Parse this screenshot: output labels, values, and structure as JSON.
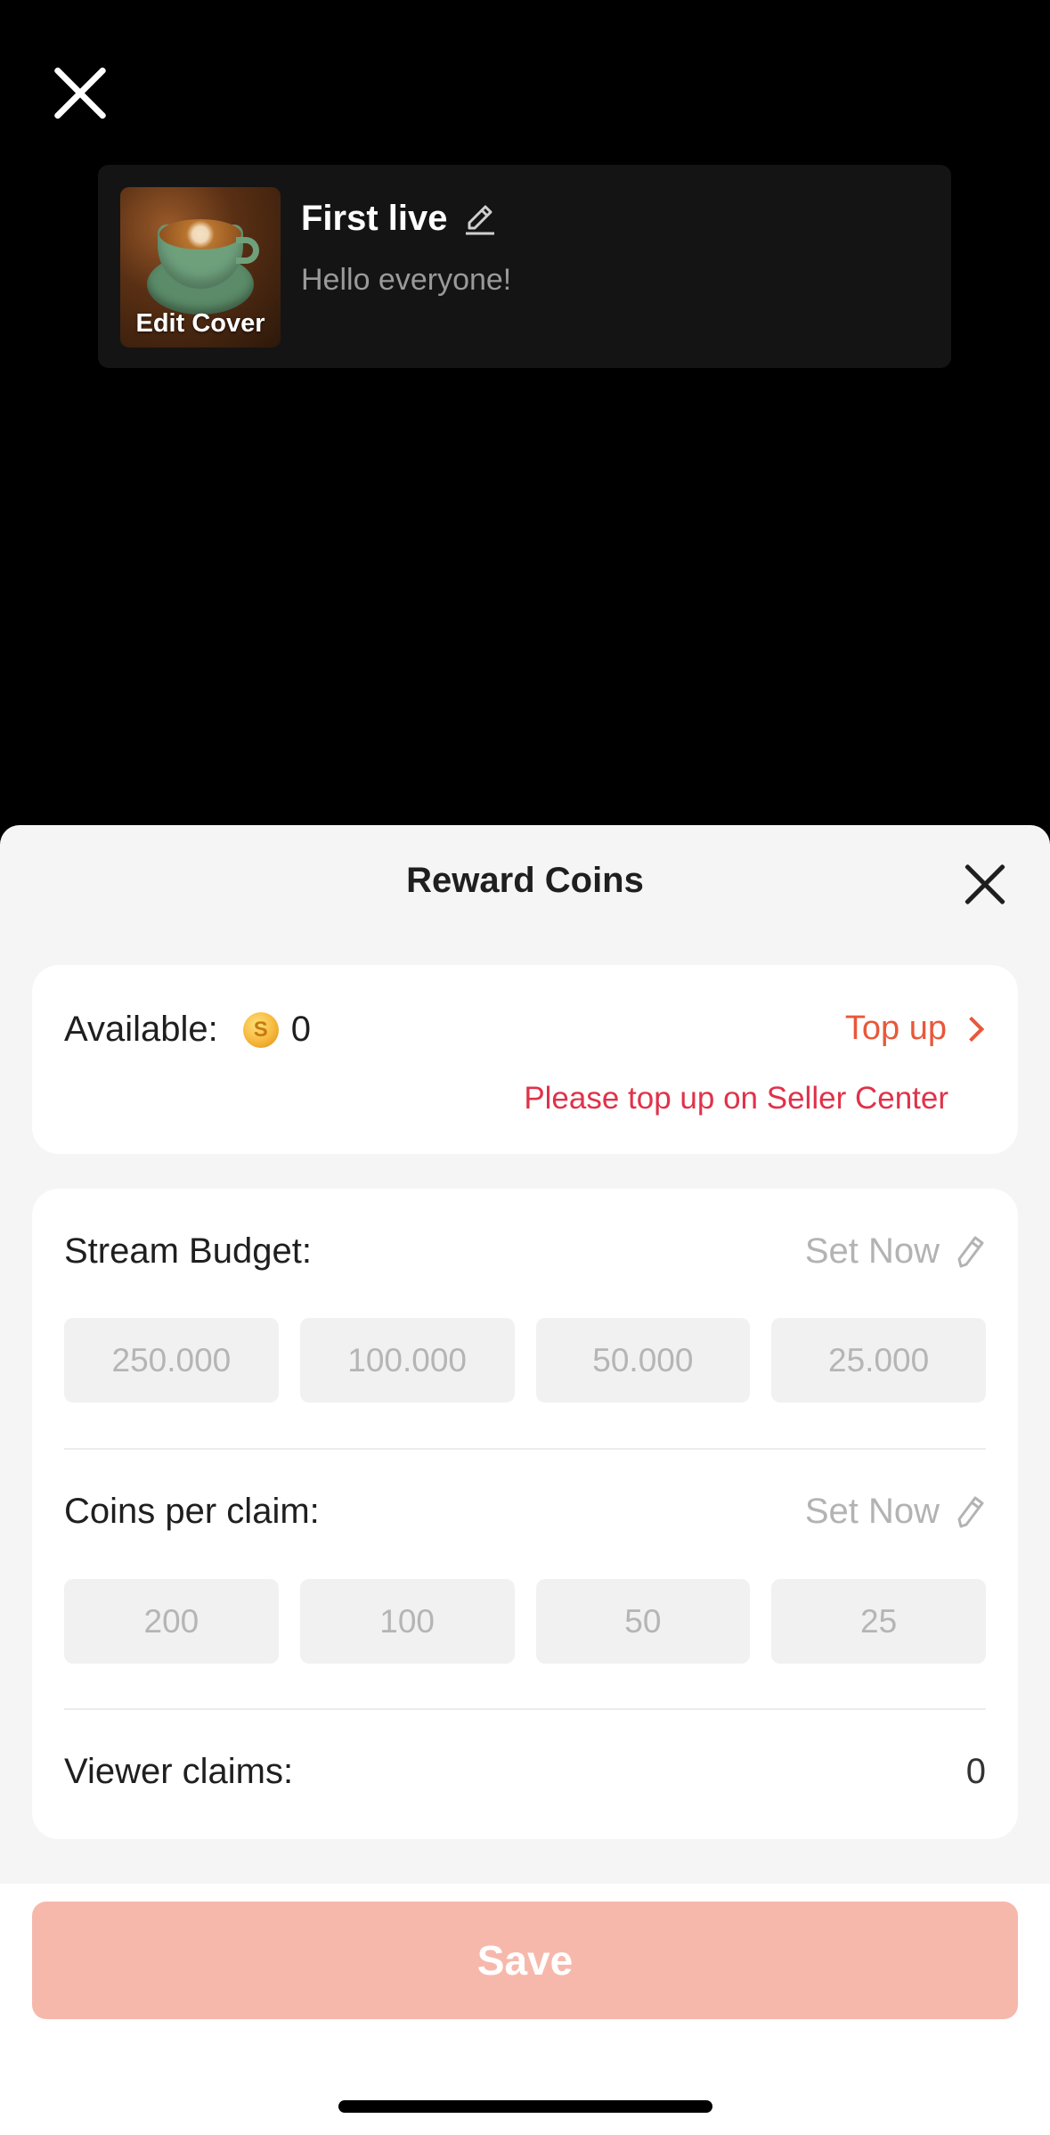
{
  "live": {
    "cover_label": "Edit Cover",
    "title": "First live",
    "subtitle": "Hello everyone!"
  },
  "sheet": {
    "title": "Reward Coins",
    "available_label": "Available:",
    "available_value": "0",
    "topup_label": "Top up",
    "topup_hint": "Please top up on Seller Center",
    "stream_budget": {
      "label": "Stream Budget:",
      "action": "Set Now",
      "options": [
        "250.000",
        "100.000",
        "50.000",
        "25.000"
      ]
    },
    "coins_per_claim": {
      "label": "Coins per claim:",
      "action": "Set Now",
      "options": [
        "200",
        "100",
        "50",
        "25"
      ]
    },
    "viewer_claims": {
      "label": "Viewer claims:",
      "value": "0"
    },
    "save_label": "Save"
  },
  "colors": {
    "accent": "#e8583a",
    "warning": "#e0324a",
    "save_disabled": "#f7b8ac"
  }
}
